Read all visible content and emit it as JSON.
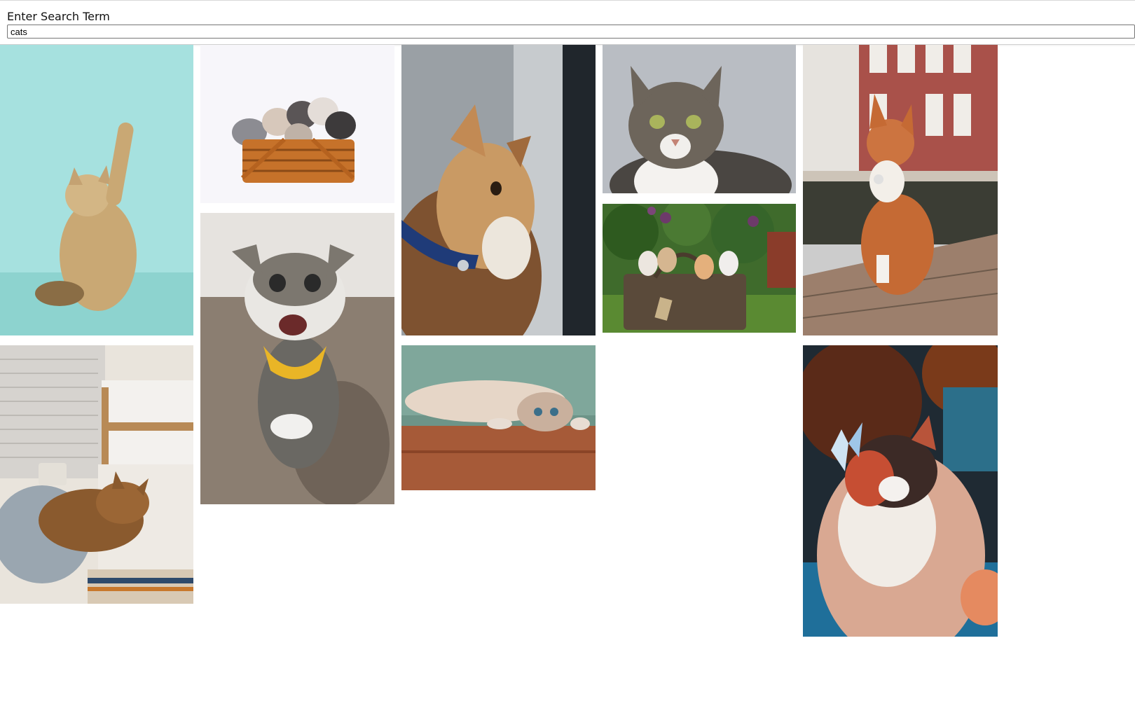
{
  "search": {
    "label": "Enter Search Term",
    "value": "cats"
  },
  "gallery": {
    "photos": [
      {
        "id": "kitten-teal-paw-up",
        "icon": "cat-photo"
      },
      {
        "id": "kittens-in-basket-white",
        "icon": "cat-photo"
      },
      {
        "id": "ginger-cat-blue-collar",
        "icon": "cat-photo"
      },
      {
        "id": "tabby-cat-portrait",
        "icon": "cat-photo"
      },
      {
        "id": "orange-cat-street",
        "icon": "cat-photo"
      },
      {
        "id": "sleeping-cat-bed",
        "icon": "cat-photo"
      },
      {
        "id": "smiling-cat-yellow-bandana",
        "icon": "cat-photo"
      },
      {
        "id": "lying-cat-wood-floor",
        "icon": "cat-photo"
      },
      {
        "id": "kittens-basket-garden",
        "icon": "cat-photo"
      },
      {
        "id": "fluffy-cat-butterfly",
        "icon": "cat-photo"
      }
    ]
  }
}
